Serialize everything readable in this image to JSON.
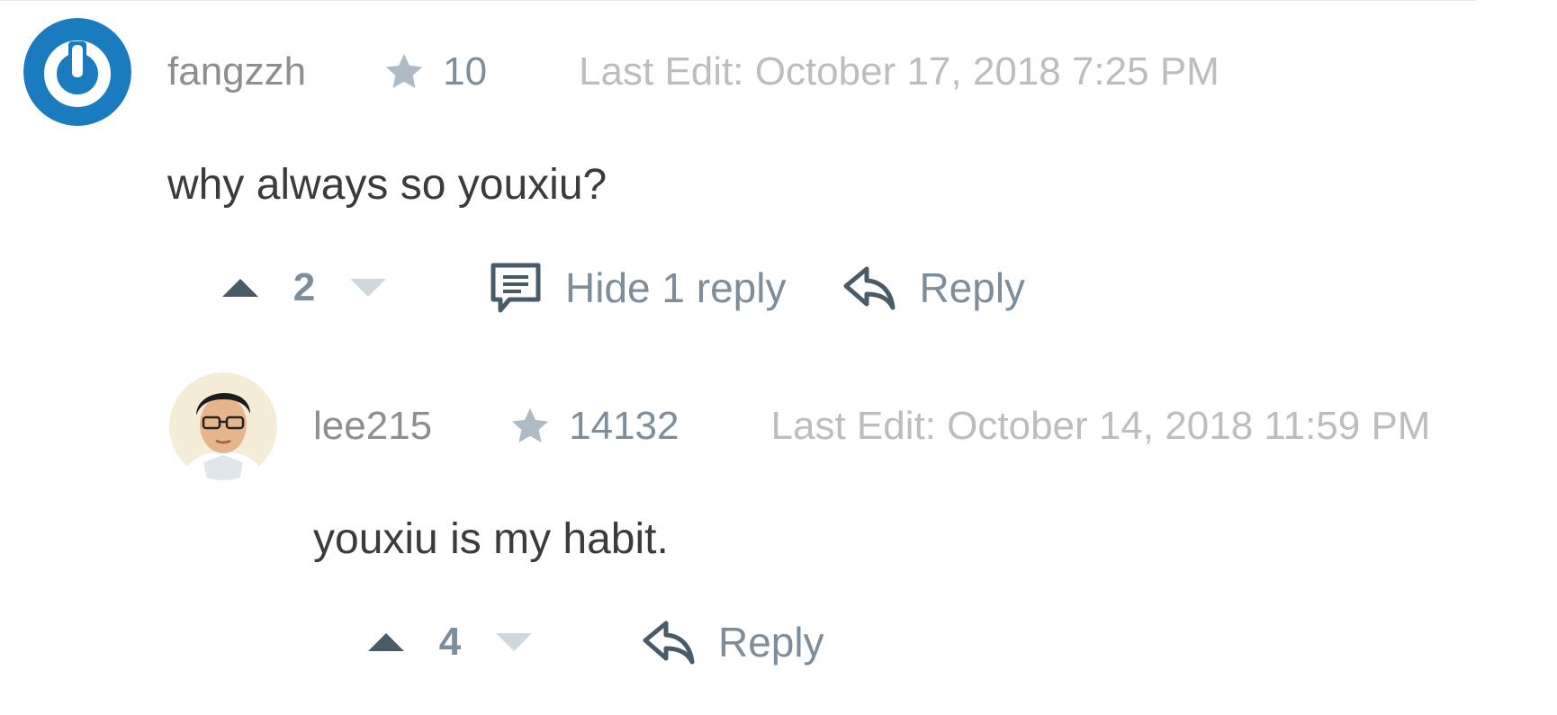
{
  "comments": [
    {
      "username": "fangzzh",
      "reputation": "10",
      "edited": "Last Edit: October 17, 2018 7:25 PM",
      "text": "why always so youxiu?",
      "votes": "2",
      "toggle_replies_label": "Hide 1 reply",
      "reply_label": "Reply",
      "avatar_icon": "power-icon",
      "avatar_color": "#1a7bbf"
    },
    {
      "username": "lee215",
      "reputation": "14132",
      "edited": "Last Edit: October 14, 2018 11:59 PM",
      "text": "youxiu is my habit.",
      "votes": "4",
      "reply_label": "Reply",
      "avatar_icon": "user-photo"
    }
  ],
  "colors": {
    "muted": "#7d8e9a",
    "upvote": "#4a5b68",
    "downvote": "#cfd8dd",
    "body_text": "#3b3b3b",
    "timestamp": "#bdbdbd"
  }
}
